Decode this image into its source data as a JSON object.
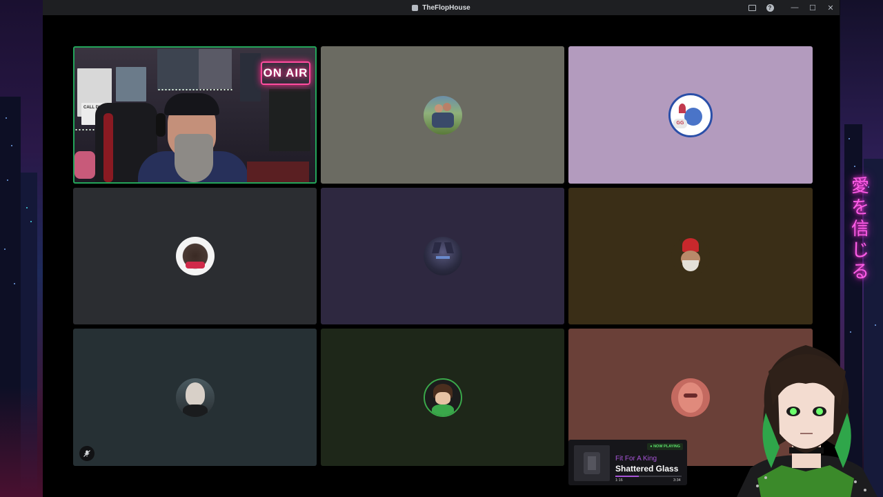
{
  "window": {
    "title": "TheFlopHouse",
    "minimize_glyph": "—",
    "maximize_glyph": "☐",
    "close_glyph": "✕",
    "help_glyph": "?"
  },
  "call": {
    "active_speaker_color": "#23a55a",
    "tiles": [
      {
        "id": "camera-streamer",
        "bg": "#2b2631",
        "kind": "camera"
      },
      {
        "id": "park-couple",
        "bg": "#6b6b62",
        "kind": "avatar"
      },
      {
        "id": "stitch-gg",
        "bg": "#b39bbe",
        "kind": "avatar"
      },
      {
        "id": "round-logo",
        "bg": "#2b2d31",
        "kind": "avatar"
      },
      {
        "id": "dark-wolf",
        "bg": "#2e2840",
        "kind": "avatar"
      },
      {
        "id": "red-hat",
        "bg": "#3a2e17",
        "kind": "avatar"
      },
      {
        "id": "bald-man",
        "bg": "#263034",
        "kind": "avatar"
      },
      {
        "id": "green-kid",
        "bg": "#1e2719",
        "kind": "avatar"
      },
      {
        "id": "red-portrait",
        "bg": "#6a4038",
        "kind": "avatar"
      }
    ],
    "camera": {
      "on_air_sign": "ON AIR",
      "poster_label": "CALL DUTY"
    },
    "muted_icon": "mic-off-icon"
  },
  "now_playing": {
    "badge": "● NOW PLAYING",
    "artist": "Fit For A King",
    "title": "Shattered Glass",
    "elapsed": "1:16",
    "duration": "3:34",
    "progress": 0.35
  },
  "wallpaper": {
    "neon_sign": "愛を信じる"
  }
}
